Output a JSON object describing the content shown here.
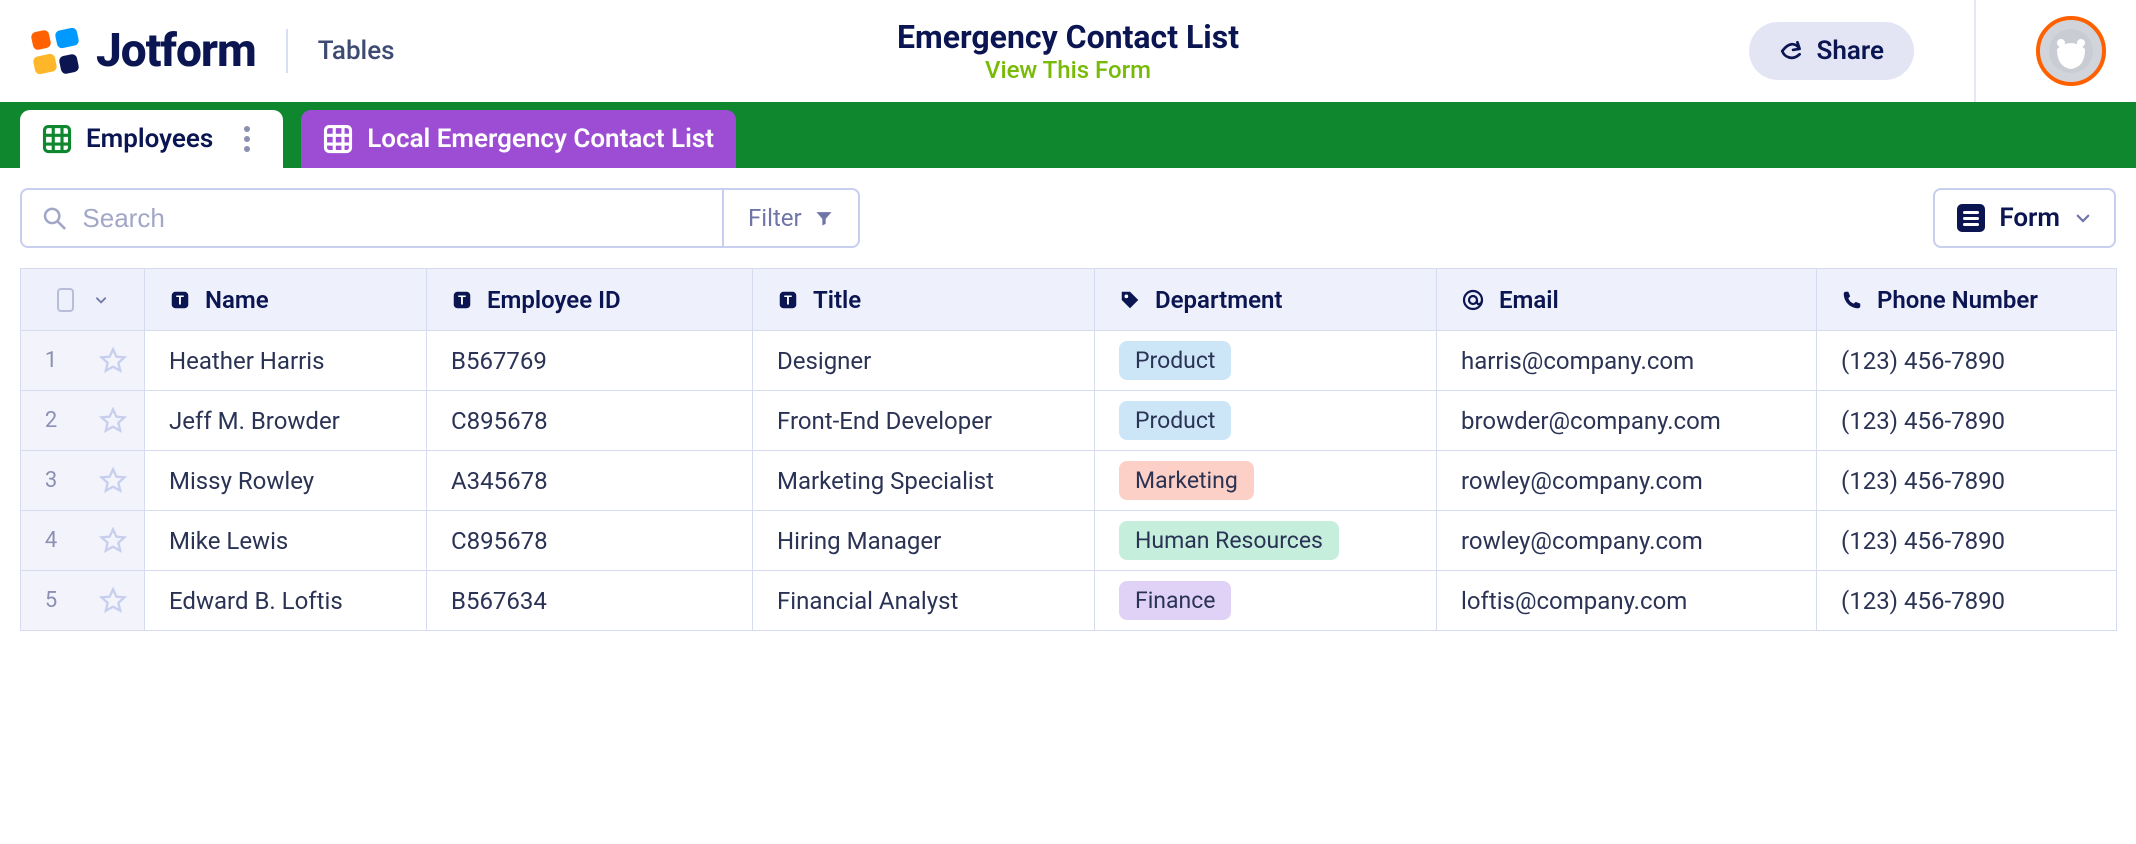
{
  "header": {
    "brand": "Jotform",
    "section": "Tables",
    "title": "Emergency Contact List",
    "view_link": "View This Form",
    "share_label": "Share"
  },
  "tabs": [
    {
      "label": "Employees",
      "active": true
    },
    {
      "label": "Local Emergency Contact List",
      "active": false
    }
  ],
  "toolbar": {
    "search_placeholder": "Search",
    "filter_label": "Filter",
    "form_label": "Form"
  },
  "columns": {
    "name": "Name",
    "employee_id": "Employee ID",
    "title": "Title",
    "department": "Department",
    "email": "Email",
    "phone": "Phone Number"
  },
  "rows": [
    {
      "idx": "1",
      "name": "Heather Harris",
      "employee_id": "B567769",
      "title": "Designer",
      "department": "Product",
      "dept_class": "tag-product",
      "email": "harris@company.com",
      "phone": "(123) 456-7890"
    },
    {
      "idx": "2",
      "name": "Jeff M. Browder",
      "employee_id": "C895678",
      "title": "Front-End Developer",
      "department": "Product",
      "dept_class": "tag-product",
      "email": "browder@company.com",
      "phone": "(123) 456-7890"
    },
    {
      "idx": "3",
      "name": "Missy Rowley",
      "employee_id": "A345678",
      "title": "Marketing Specialist",
      "department": "Marketing",
      "dept_class": "tag-marketing",
      "email": "rowley@company.com",
      "phone": "(123) 456-7890"
    },
    {
      "idx": "4",
      "name": "Mike Lewis",
      "employee_id": "C895678",
      "title": "Hiring Manager",
      "department": "Human Resources",
      "dept_class": "tag-hr",
      "email": "rowley@company.com",
      "phone": "(123) 456-7890"
    },
    {
      "idx": "5",
      "name": "Edward B. Loftis",
      "employee_id": "B567634",
      "title": "Financial Analyst",
      "department": "Finance",
      "dept_class": "tag-finance",
      "email": "loftis@company.com",
      "phone": "(123) 456-7890"
    }
  ]
}
